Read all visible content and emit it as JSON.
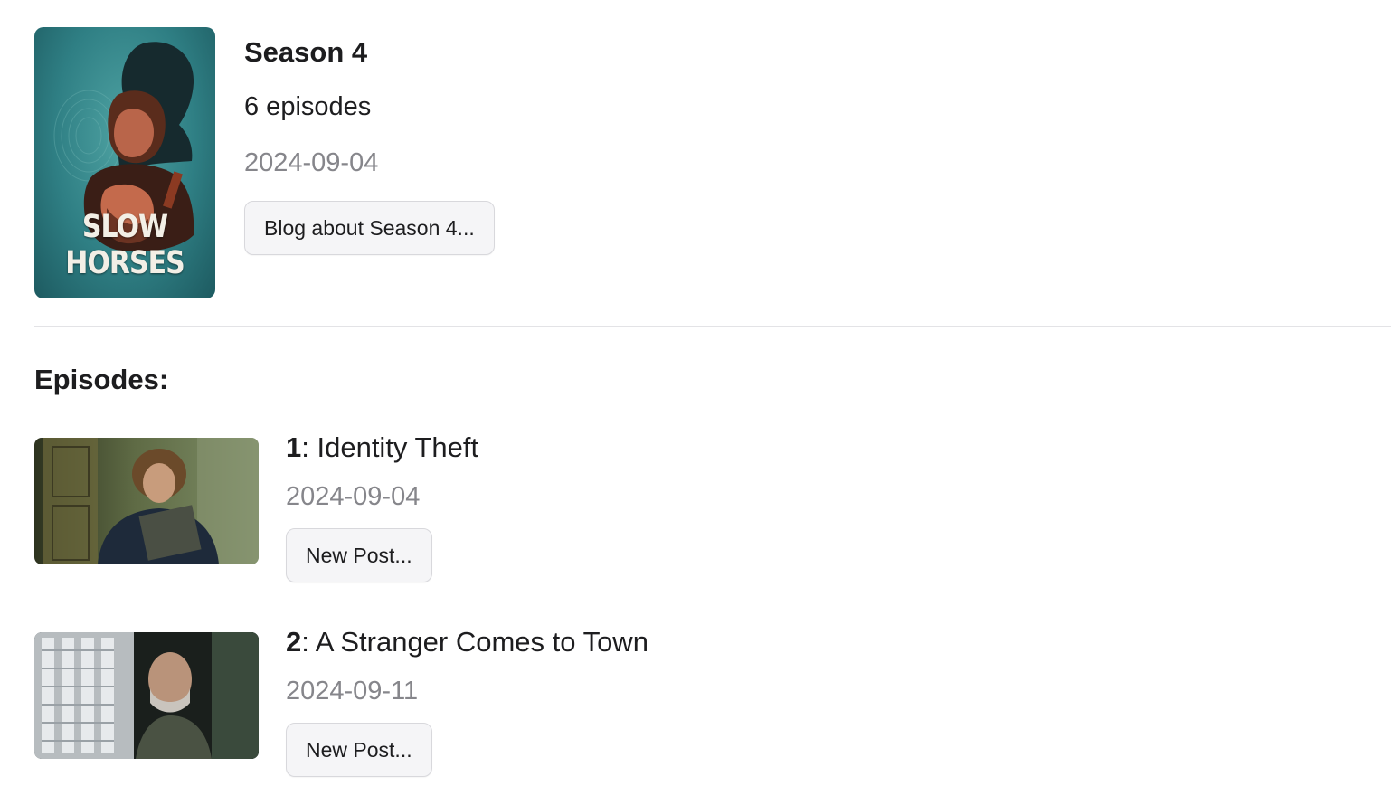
{
  "season": {
    "poster_logo": "SLOW HORSES",
    "title": "Season 4",
    "episode_count": "6 episodes",
    "air_date": "2024-09-04",
    "blog_button_label": "Blog about Season 4..."
  },
  "episodes_heading": "Episodes:",
  "episodes": [
    {
      "number": "1",
      "separator": ": ",
      "title": "Identity Theft",
      "air_date": "2024-09-04",
      "button_label": "New Post..."
    },
    {
      "number": "2",
      "separator": ": ",
      "title": "A Stranger Comes to Town",
      "air_date": "2024-09-11",
      "button_label": "New Post..."
    }
  ],
  "colors": {
    "text_primary": "#1d1d1f",
    "text_secondary": "#86868b",
    "button_bg": "#f5f5f7",
    "button_border": "#d8d8dc",
    "divider": "#e3e3e6",
    "poster_teal": "#2f7f84"
  }
}
